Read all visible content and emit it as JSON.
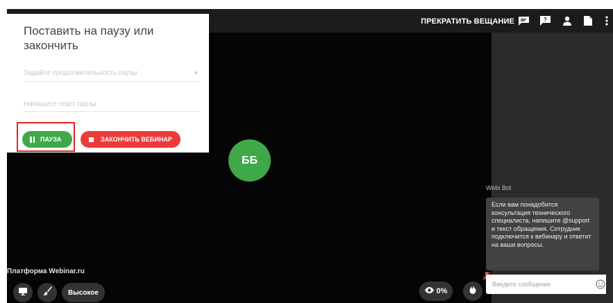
{
  "header": {
    "stop_broadcast_label": "ПРЕКРАТИТЬ ВЕЩАНИЕ",
    "icons": [
      "chat-icon",
      "question-icon",
      "participants-icon",
      "document-icon",
      "more-vertical-icon"
    ]
  },
  "pause_dialog": {
    "title": "Поставить на паузу или закончить",
    "duration_select_placeholder": "Задайте продолжительность паузы",
    "pause_text_placeholder": "Напишите текст паузы",
    "pause_button_label": "ПАУЗА",
    "end_button_label": "ЗАКОНЧИТЬ ВЕБИНАР"
  },
  "stage": {
    "avatar_initials": "ББ",
    "platform_label": "Платформа Webinar.ru"
  },
  "controls": {
    "quality_label": "Высокое",
    "views_value": "0%",
    "icons": [
      "presentation-icon",
      "brush-icon",
      "eye-icon",
      "fire-icon",
      "mic-off-icon"
    ]
  },
  "chat": {
    "messages": [
      {
        "author": "Webi Bot",
        "text": "Если вам понадобится консультация технического специалиста, напишите @support и текст обращения. Сотрудник подключится к вебинару и ответит на ваши вопросы."
      }
    ],
    "input_placeholder": "Введите сообщение"
  },
  "colors": {
    "accent_green": "#3fa94a",
    "danger_red": "#ec3b3b",
    "highlight_red": "#e0261f",
    "stage_background": "#050505",
    "chat_background": "#2b2b2b"
  }
}
